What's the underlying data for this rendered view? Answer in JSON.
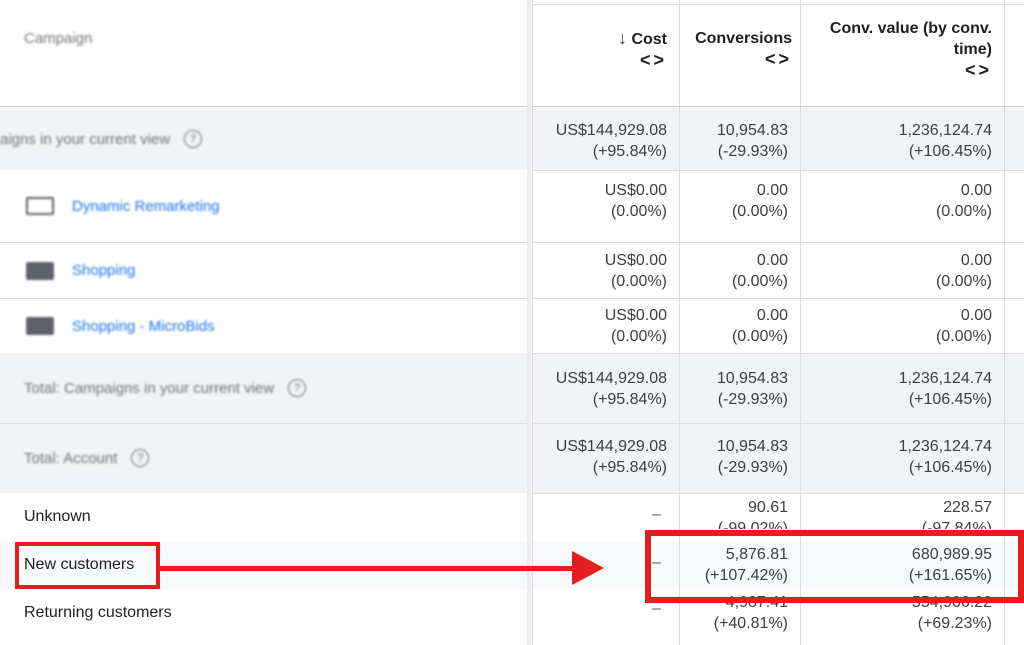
{
  "header": {
    "campaign": "Campaign",
    "cost": "Cost",
    "sort_arrow": "↓",
    "conversions": "Conversions",
    "conv_value_line1": "Conv. value (by conv.",
    "conv_value_line2": "time)",
    "chevrons": "<>"
  },
  "rows": [
    {
      "label": "aigns in your current view",
      "cost": "US$144,929.08",
      "cost_change": "(+95.84%)",
      "conv": "10,954.83",
      "conv_change": "(-29.93%)",
      "value": "1,236,124.74",
      "value_change": "(+106.45%)"
    },
    {
      "label": "Dynamic Remarketing",
      "cost": "US$0.00",
      "cost_change": "(0.00%)",
      "conv": "0.00",
      "conv_change": "(0.00%)",
      "value": "0.00",
      "value_change": "(0.00%)"
    },
    {
      "label": "Shopping",
      "cost": "US$0.00",
      "cost_change": "(0.00%)",
      "conv": "0.00",
      "conv_change": "(0.00%)",
      "value": "0.00",
      "value_change": "(0.00%)"
    },
    {
      "label": "Shopping - MicroBids",
      "cost": "US$0.00",
      "cost_change": "(0.00%)",
      "conv": "0.00",
      "conv_change": "(0.00%)",
      "value": "0.00",
      "value_change": "(0.00%)"
    },
    {
      "label": "Total: Campaigns in your current view",
      "cost": "US$144,929.08",
      "cost_change": "(+95.84%)",
      "conv": "10,954.83",
      "conv_change": "(-29.93%)",
      "value": "1,236,124.74",
      "value_change": "(+106.45%)"
    },
    {
      "label": "Total: Account",
      "cost": "US$144,929.08",
      "cost_change": "(+95.84%)",
      "conv": "10,954.83",
      "conv_change": "(-29.93%)",
      "value": "1,236,124.74",
      "value_change": "(+106.45%)"
    },
    {
      "label": "Unknown",
      "cost": "–",
      "conv": "90.61",
      "conv_change": "(-99.02%)",
      "value": "228.57",
      "value_change": "(-97.84%)"
    },
    {
      "label": "New customers",
      "cost": "–",
      "conv": "5,876.81",
      "conv_change": "(+107.42%)",
      "value": "680,989.95",
      "value_change": "(+161.65%)"
    },
    {
      "label": "Returning customers",
      "cost": "–",
      "conv": "4,987.41",
      "conv_change": "(+40.81%)",
      "value": "554,906.22",
      "value_change": "(+69.23%)"
    }
  ],
  "help_icon": "?",
  "accent_color": "#e41e1e",
  "link_color": "#1a73e8"
}
